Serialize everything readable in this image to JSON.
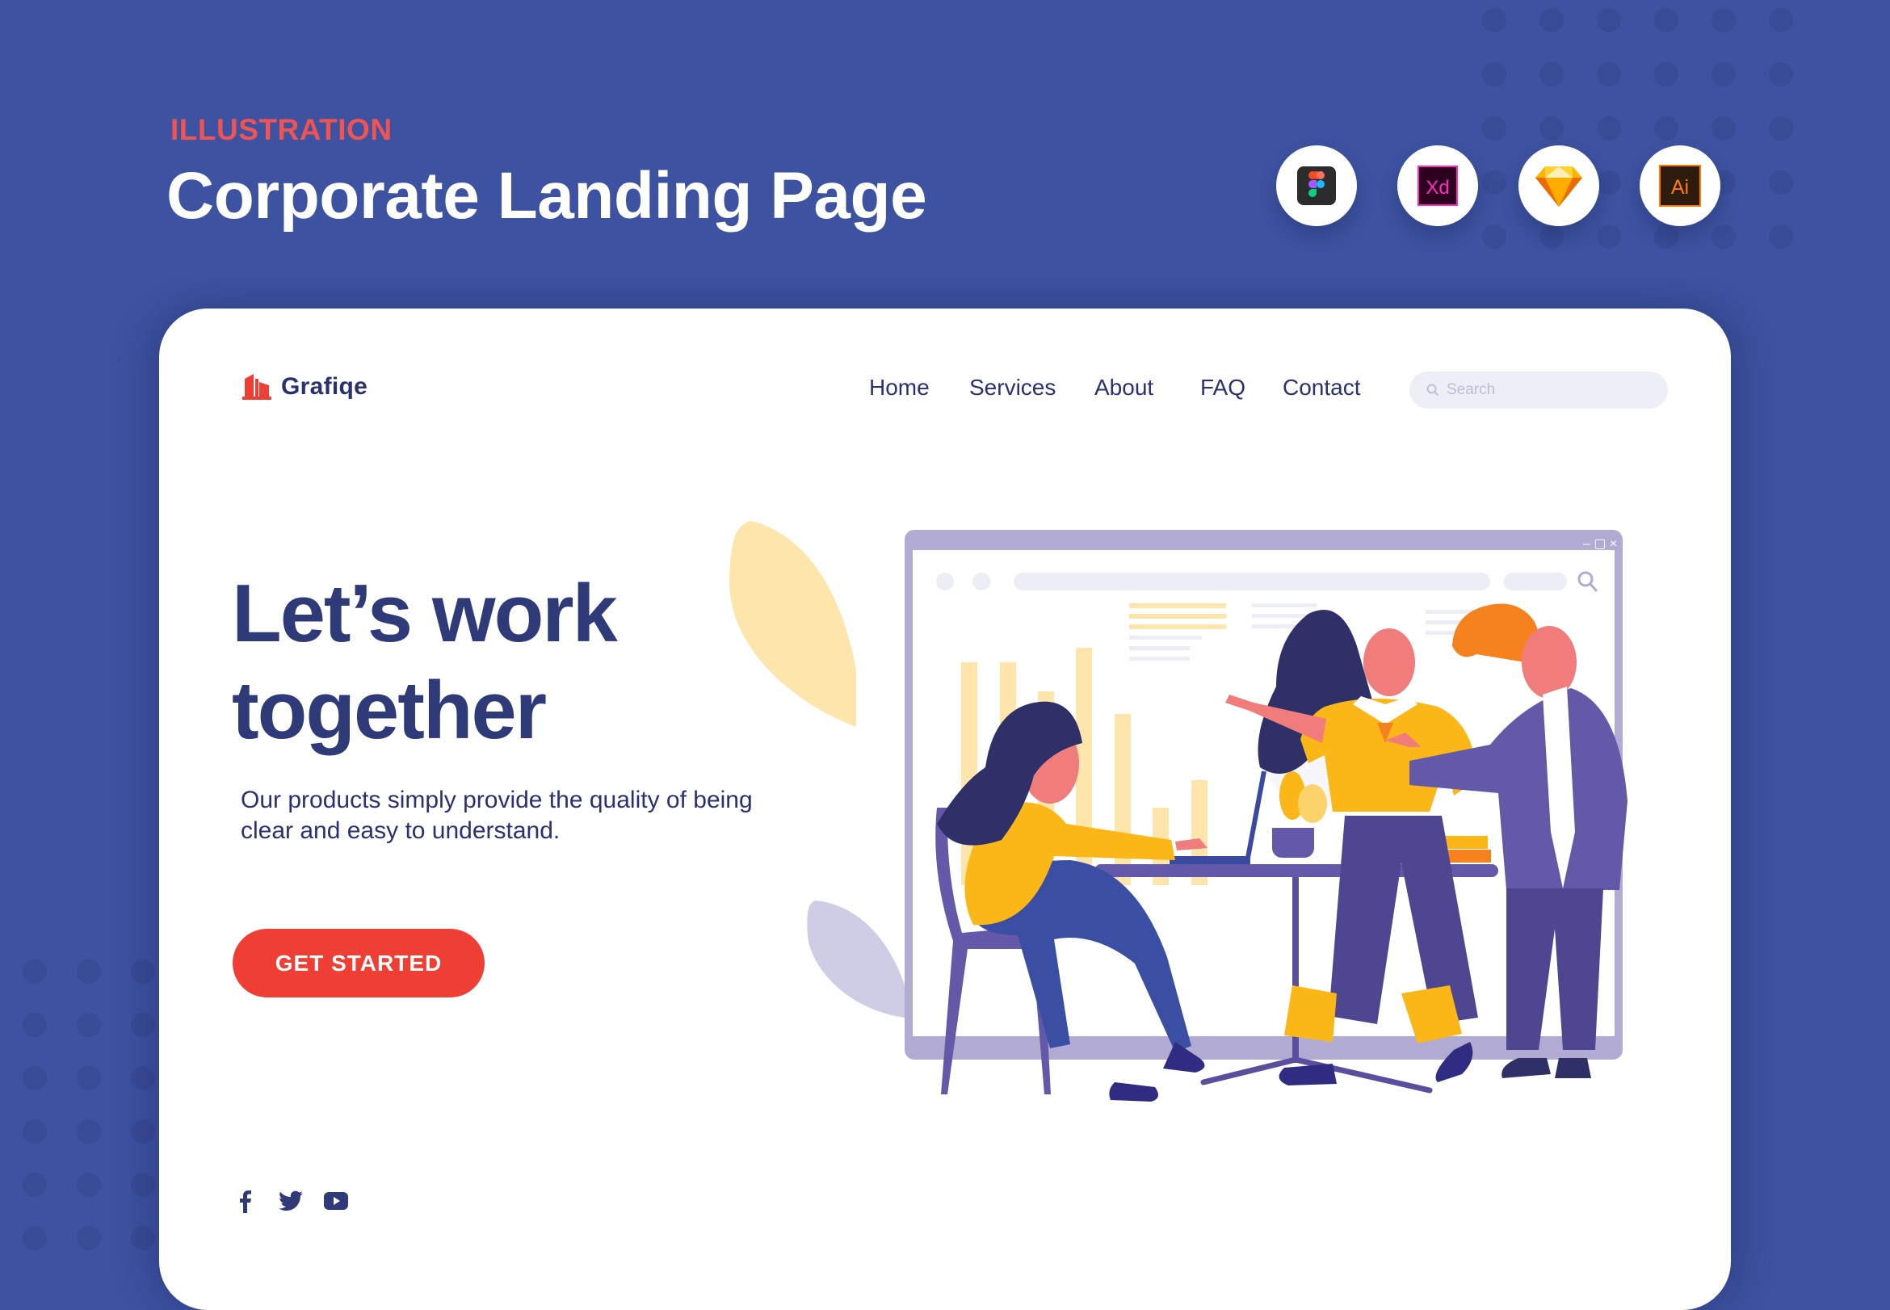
{
  "header": {
    "eyebrow": "ILLUSTRATION",
    "title": "Corporate Landing Page"
  },
  "tools": [
    {
      "name": "Figma",
      "icon": "figma-icon"
    },
    {
      "name": "Adobe XD",
      "icon": "xd-icon",
      "label": "Xd"
    },
    {
      "name": "Sketch",
      "icon": "sketch-icon"
    },
    {
      "name": "Adobe Illustrator",
      "icon": "illustrator-icon",
      "label": "Ai"
    }
  ],
  "site": {
    "brand": "Grafiqe",
    "nav": [
      {
        "label": "Home"
      },
      {
        "label": "Services"
      },
      {
        "label": "About"
      },
      {
        "label": "FAQ"
      },
      {
        "label": "Contact"
      }
    ],
    "search": {
      "placeholder": "Search",
      "value": ""
    },
    "hero": {
      "title_line1": "Let’s work",
      "title_line2": "together",
      "description": "Our products simply provide the quality of being clear and easy to understand.",
      "cta_label": "GET STARTED"
    },
    "social": [
      {
        "name": "facebook",
        "icon": "facebook-icon"
      },
      {
        "name": "twitter",
        "icon": "twitter-icon"
      },
      {
        "name": "youtube",
        "icon": "youtube-icon"
      }
    ],
    "illustration": {
      "window_controls": [
        "–",
        "▢",
        "×"
      ]
    }
  },
  "colors": {
    "background": "#3d52a0",
    "accent_red": "#ef3e33",
    "eyebrow_red": "#ef5454",
    "navy_text": "#2a3170",
    "headline": "#2f3a78",
    "illustration_purple": "#6359a8",
    "illustration_yellow": "#fbb718",
    "illustration_orange": "#f5821f",
    "frame_lavender": "#b1abd3"
  }
}
